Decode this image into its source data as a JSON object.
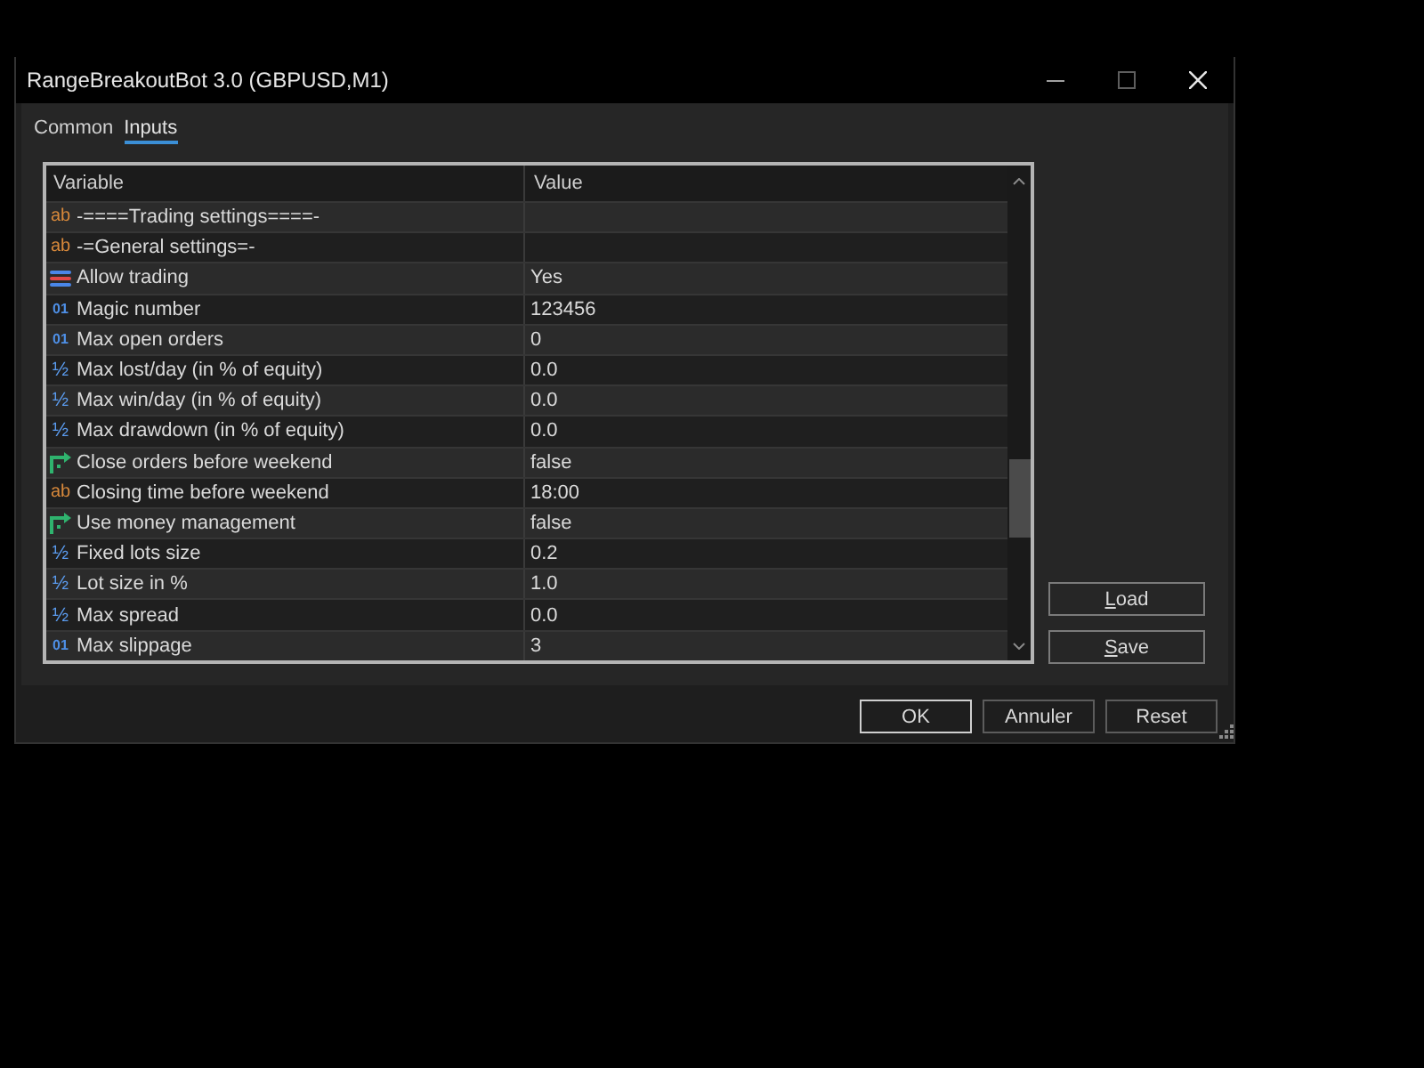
{
  "window": {
    "title": "RangeBreakoutBot 3.0 (GBPUSD,M1)"
  },
  "tabs": [
    {
      "label": "Common",
      "selected": false
    },
    {
      "label": "Inputs",
      "selected": true
    }
  ],
  "table": {
    "columns": [
      "Variable",
      "Value"
    ],
    "rows": [
      {
        "kind": "string",
        "type_glyph": "ab",
        "variable": "-====Trading settings====-"
      },
      {
        "kind": "string",
        "type_glyph": "ab",
        "variable": "-=General settings=-"
      },
      {
        "kind": "enum",
        "variable": "Allow trading",
        "value": "Yes"
      },
      {
        "kind": "int",
        "type_glyph": "01",
        "variable": "Magic number",
        "value": "123456"
      },
      {
        "kind": "int",
        "type_glyph": "01",
        "variable": "Max open orders",
        "value": "0"
      },
      {
        "kind": "double",
        "type_glyph": "½",
        "variable": "Max lost/day (in % of equity)",
        "value": "0.0"
      },
      {
        "kind": "double",
        "type_glyph": "½",
        "variable": "Max win/day (in % of equity)",
        "value": "0.0"
      },
      {
        "kind": "double",
        "type_glyph": "½",
        "variable": "Max drawdown (in % of equity)",
        "value": "0.0"
      },
      {
        "kind": "bool",
        "variable": "Close orders before weekend",
        "value": "false"
      },
      {
        "kind": "string",
        "type_glyph": "ab",
        "variable": "Closing time before weekend",
        "value": "18:00"
      },
      {
        "kind": "bool",
        "variable": "Use money management",
        "value": "false"
      },
      {
        "kind": "double",
        "type_glyph": "½",
        "variable": "Fixed lots size",
        "value": "0.2"
      },
      {
        "kind": "double",
        "type_glyph": "½",
        "variable": "Lot size in %",
        "value": "1.0"
      },
      {
        "kind": "double",
        "type_glyph": "½",
        "variable": "Max spread",
        "value": "0.0"
      },
      {
        "kind": "int",
        "type_glyph": "01",
        "variable": "Max slippage",
        "value": "3"
      }
    ]
  },
  "side_buttons": [
    {
      "access_key": "L",
      "label_rest": "oad"
    },
    {
      "access_key": "S",
      "label_rest": "ave"
    }
  ],
  "buttons": [
    {
      "label": "OK",
      "default": true
    },
    {
      "label": "Annuler",
      "default": false
    },
    {
      "label": "Reset",
      "default": false
    }
  ]
}
